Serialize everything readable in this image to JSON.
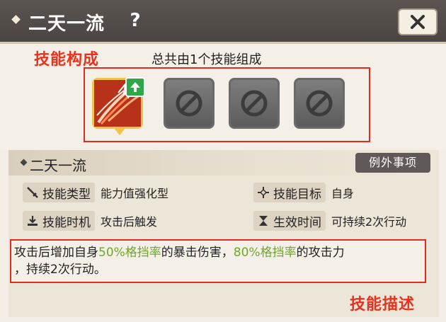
{
  "header": {
    "title": "二天一流",
    "help_label": "?",
    "close_icon": "close-icon"
  },
  "composition": {
    "annotation": "技能构成",
    "summary": "总共由1个技能组成",
    "slots": [
      {
        "state": "active",
        "icon": "sword-skill-icon",
        "badge": "upgrade-arrow-icon"
      },
      {
        "state": "locked",
        "icon": "prohibited-icon"
      },
      {
        "state": "locked",
        "icon": "prohibited-icon"
      },
      {
        "state": "locked",
        "icon": "prohibited-icon"
      }
    ]
  },
  "skill": {
    "name": "二天一流",
    "exception_label": "例外事项",
    "type_label": "技能类型",
    "type_value": "能力值强化型",
    "target_label": "技能目标",
    "target_value": "自身",
    "timing_label": "技能时机",
    "timing_value": "攻击后触发",
    "duration_label": "生效时间",
    "duration_value": "可持续2次行动",
    "desc_1": "攻击后增加自身",
    "desc_hl_1": "50%格挡率",
    "desc_2": "的暴击伤害，",
    "desc_hl_2": "80%格挡率",
    "desc_3": "的攻击力",
    "desc_4": "，持续2次行动。",
    "desc_annotation": "技能描述"
  },
  "colors": {
    "annotation_red": "#e8321e",
    "highlight_green": "#6fa52c",
    "header_bg": "#4a4542"
  }
}
